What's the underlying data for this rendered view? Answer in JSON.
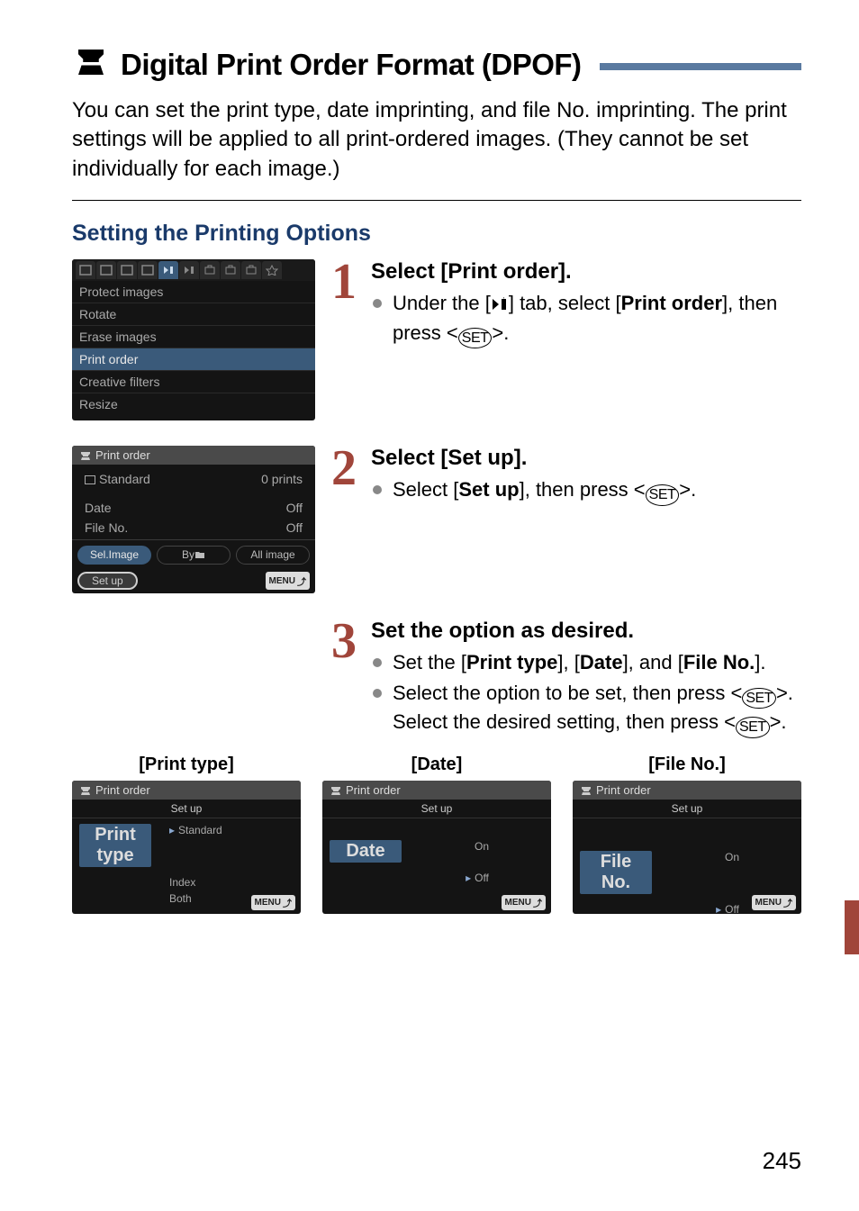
{
  "title": "Digital Print Order Format (DPOF)",
  "intro": "You can set the print type, date imprinting, and file No. imprinting. The print settings will be applied to all print-ordered images. (They cannot be set individually for each image.)",
  "section_heading": "Setting the Printing Options",
  "steps": {
    "s1": {
      "num": "1",
      "heading": "Select [Print order].",
      "bullet_pre": "Under the [",
      "bullet_mid": "] tab, select [",
      "bullet_bold": "Print order",
      "bullet_post": "], then press <",
      "bullet_end": ">."
    },
    "s2": {
      "num": "2",
      "heading": "Select [Set up].",
      "bullet_pre": "Select [",
      "bullet_bold": "Set up",
      "bullet_post": "], then press <",
      "bullet_end": ">."
    },
    "s3": {
      "num": "3",
      "heading": "Set the option as desired.",
      "b1_pre": "Set the [",
      "b1_a": "Print type",
      "b1_sep1": "], [",
      "b1_b": "Date",
      "b1_sep2": "], and [",
      "b1_c": "File No.",
      "b1_end": "].",
      "b2_pre": "Select the option to be set, then press <",
      "b2_mid": ">. Select the desired setting, then press <",
      "b2_end": ">."
    }
  },
  "cam1": {
    "items": [
      "Protect images",
      "Rotate",
      "Erase images",
      "Print order",
      "Creative filters",
      "Resize"
    ]
  },
  "cam2": {
    "title": "Print order",
    "standard": "Standard",
    "prints": "0 prints",
    "date_label": "Date",
    "date_val": "Off",
    "fileno_label": "File No.",
    "fileno_val": "Off",
    "b_sel": "Sel.Image",
    "b_by": "By",
    "b_all": "All image",
    "setup": "Set up",
    "menu": "MENU"
  },
  "triple_labels": {
    "a": "Print type",
    "b": "Date",
    "c": "File No."
  },
  "camA": {
    "title": "Print order",
    "sub": "Set up",
    "row_label": "Print type",
    "opts": [
      "Standard",
      "Index",
      "Both"
    ],
    "menu": "MENU"
  },
  "camB": {
    "title": "Print order",
    "sub": "Set up",
    "row_label": "Date",
    "opts": [
      "On",
      "Off"
    ],
    "menu": "MENU"
  },
  "camC": {
    "title": "Print order",
    "sub": "Set up",
    "row_label": "File No.",
    "opts": [
      "On",
      "Off"
    ],
    "menu": "MENU"
  },
  "set_label": "SET",
  "page_number": "245"
}
